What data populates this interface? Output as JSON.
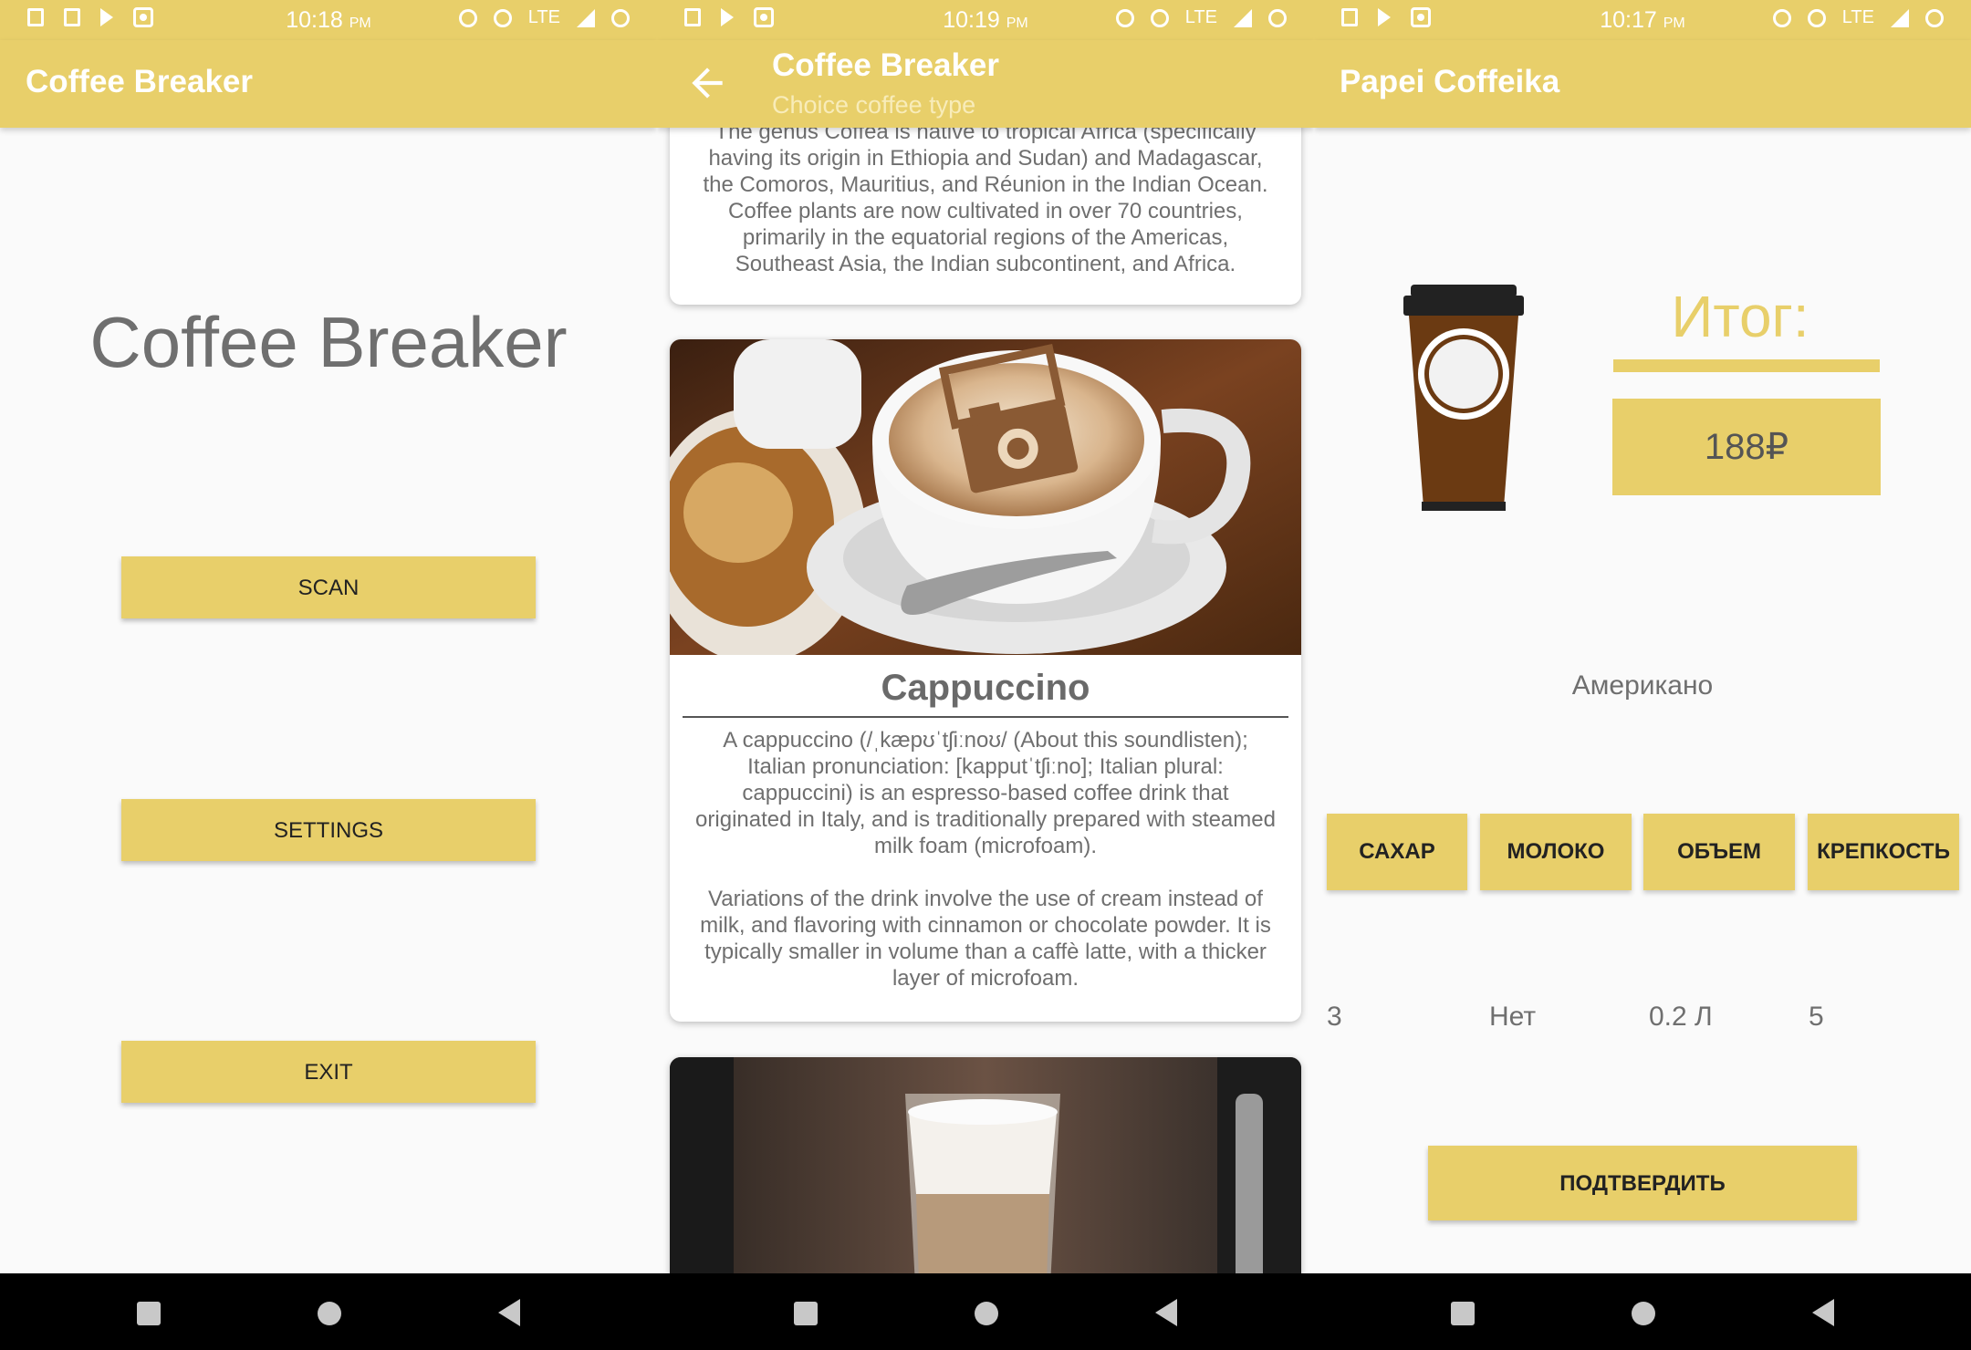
{
  "status_bars": [
    {
      "time": "10:18",
      "ampm": "PM",
      "network": "LTE"
    },
    {
      "time": "10:19",
      "ampm": "PM",
      "network": "LTE"
    },
    {
      "time": "10:17",
      "ampm": "PM",
      "network": "LTE"
    }
  ],
  "screen_main": {
    "appbar_title": "Coffee Breaker",
    "heading": "Coffee Breaker",
    "buttons": {
      "scan": "SCAN",
      "settings": "SETTINGS",
      "exit": "EXIT"
    }
  },
  "screen_list": {
    "appbar_title": "Coffee Breaker",
    "appbar_subtitle": "Choice coffee type",
    "top_card_text": "The genus Coffea is native to tropical Africa (specifically\nhaving its origin in Ethiopia and Sudan) and Madagascar,\nthe Comoros, Mauritius, and Réunion in the Indian Ocean.\nCoffee plants are now cultivated in over 70 countries,\nprimarily in the equatorial regions of the Americas,\nSoutheast Asia, the Indian subcontinent, and Africa.",
    "cappuccino": {
      "title": "Cappuccino",
      "text": "A cappuccino (/ˌkæpʊˈtʃiːnoʊ/ (About this soundlisten);\nItalian pronunciation: [kapputˈtʃiːno]; Italian plural:\ncappuccini) is an espresso-based coffee drink that\noriginated in Italy, and is traditionally prepared with steamed\nmilk foam (microfoam).\n\nVariations of the drink involve the use of cream instead of\nmilk, and flavoring with cinnamon or chocolate powder. It is\ntypically smaller in volume than a caffè latte, with a thicker\nlayer of microfoam."
    }
  },
  "screen_order": {
    "appbar_title": "Papei Coffeika",
    "total_label": "Итог:",
    "price": "188₽",
    "drink_name": "Американо",
    "options": [
      {
        "label": "САХАР",
        "value": "3"
      },
      {
        "label": "МОЛОКО",
        "value": "Нет"
      },
      {
        "label": "ОБЪЕМ",
        "value": "0.2 Л"
      },
      {
        "label": "КРЕПКОСТЬ",
        "value": "5"
      }
    ],
    "confirm_label": "ПОДТВЕРДИТЬ"
  },
  "colors": {
    "accent": "#e8cf6a",
    "text_gray": "#6f6f6f",
    "cup_brown": "#6b3a12"
  }
}
